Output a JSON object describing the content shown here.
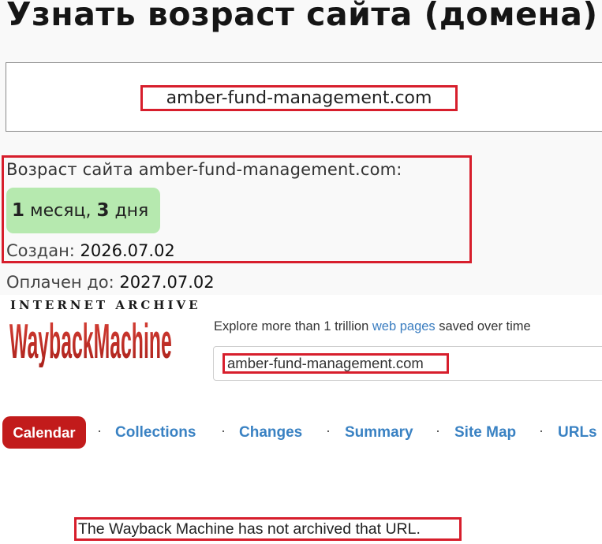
{
  "header": {
    "title": "Узнать возраст сайта (домена)"
  },
  "domain_input": {
    "value": "amber-fund-management.com"
  },
  "result": {
    "age_label": "Возраст сайта amber-fund-management.com:",
    "age_months_num": "1",
    "age_months_unit": " месяц, ",
    "age_days_num": "3",
    "age_days_unit": " дня",
    "created_label": "Создан: ",
    "created_value": "2026.07.02",
    "paid_label": "Оплачен до: ",
    "paid_value": "2027.07.02"
  },
  "wayback": {
    "brand_top": "INTERNET ARCHIVE",
    "brand_logo": "WaybackMachine",
    "explore_prefix": "Explore more than 1 trillion ",
    "explore_link": "web pages",
    "explore_suffix": " saved over time",
    "search_value": "amber-fund-management.com",
    "tabs": [
      {
        "label": "Calendar",
        "active": true
      },
      {
        "label": "Collections"
      },
      {
        "label": "Changes"
      },
      {
        "label": "Summary"
      },
      {
        "label": "Site Map"
      },
      {
        "label": "URLs"
      }
    ],
    "separator": "·",
    "message": "The Wayback Machine has not archived that URL."
  },
  "colors": {
    "highlight_border": "#d71e2c",
    "age_badge_bg": "#b6e9af",
    "calendar_active": "#c21b1b",
    "link_blue": "#3a82c3"
  }
}
